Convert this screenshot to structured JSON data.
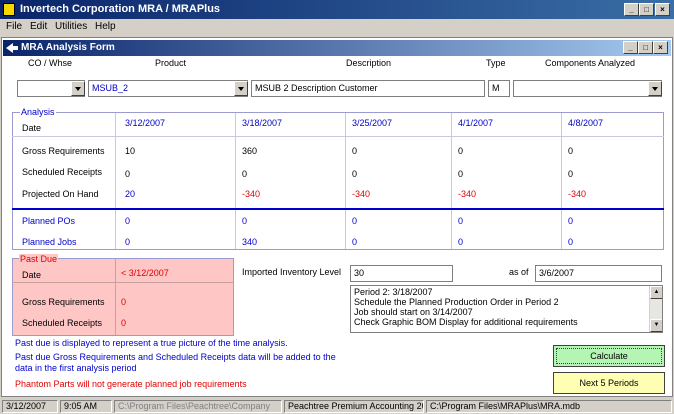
{
  "app": {
    "title": "Invertech Corporation MRA / MRAPlus",
    "menu": [
      "File",
      "Edit",
      "Utilities",
      "Help"
    ]
  },
  "form": {
    "title": "MRA Analysis Form",
    "columns": {
      "co_whse": "CO / Whse",
      "product": "Product",
      "description": "Description",
      "type": "Type",
      "components": "Components Analyzed"
    },
    "fields": {
      "co_whse": "",
      "product": "MSUB_2",
      "description": "MSUB 2 Description Customer",
      "type": "M",
      "components": ""
    }
  },
  "analysis": {
    "caption": "Analysis",
    "date_label": "Date",
    "dates": [
      "3/12/2007",
      "3/18/2007",
      "3/25/2007",
      "4/1/2007",
      "4/8/2007"
    ],
    "rows": [
      {
        "label": "Gross Requirements",
        "values": [
          "10",
          "360",
          "0",
          "0",
          "0"
        ]
      },
      {
        "label": "Scheduled Receipts",
        "values": [
          "0",
          "0",
          "0",
          "0",
          "0"
        ]
      },
      {
        "label": "Projected On Hand",
        "values": [
          "20",
          "-340",
          "-340",
          "-340",
          "-340"
        ]
      }
    ],
    "planned": [
      {
        "label": "Planned POs",
        "values": [
          "0",
          "0",
          "0",
          "0",
          "0"
        ]
      },
      {
        "label": "Planned Jobs",
        "values": [
          "0",
          "340",
          "0",
          "0",
          "0"
        ]
      }
    ]
  },
  "past_due": {
    "caption": "Past Due",
    "date_label": "Date",
    "date_value": "< 3/12/2007",
    "gross_label": "Gross Requirements",
    "gross_value": "0",
    "sched_label": "Scheduled Receipts",
    "sched_value": "0"
  },
  "inventory": {
    "label": "Imported Inventory Level",
    "value": "30",
    "as_of_label": "as of",
    "as_of_value": "3/6/2007"
  },
  "memo_lines": [
    "Period 2: 3/18/2007",
    "Schedule the Planned Production Order in Period 2",
    "Job should start on 3/14/2007",
    "Check Graphic BOM Display for additional requirements"
  ],
  "notes": {
    "line1": "Past due is displayed to represent a true picture of the time analysis.",
    "line2": "Past due Gross Requirements and Scheduled Receipts data will be added to the",
    "line3": "data in the first analysis period",
    "line4": "Phantom Parts will not generate planned job requirements"
  },
  "buttons": {
    "calculate": "Calculate",
    "next": "Next 5 Periods"
  },
  "status": {
    "date": "3/12/2007",
    "time": "9:05 AM",
    "path1": "C:\\Program Files\\Peachtree\\Company",
    "product": "Peachtree Premium Accounting 2005",
    "path2": "C:\\Program Files\\MRAPlus\\MRA.mdb"
  },
  "colors": {
    "title_bar": "#0a246a",
    "accent_blue": "#0000cc",
    "negative_red": "#e00000",
    "past_due_bg": "#ffc6c6",
    "calculate_bg": "#b4f5b4",
    "next_bg": "#ffffb4"
  }
}
